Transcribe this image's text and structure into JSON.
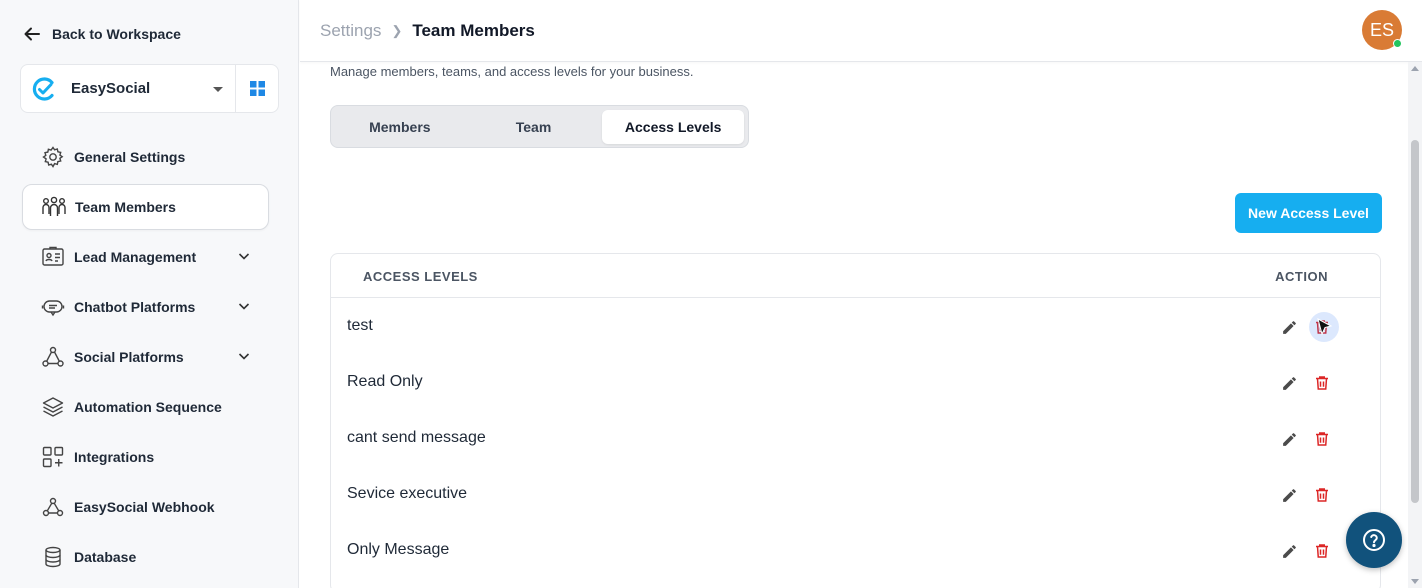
{
  "sidebar": {
    "back_label": "Back to Workspace",
    "workspace_name": "EasySocial",
    "items": [
      {
        "label": "General Settings",
        "icon": "gear-icon",
        "active": false,
        "expandable": false
      },
      {
        "label": "Team Members",
        "icon": "team-icon",
        "active": true,
        "expandable": false
      },
      {
        "label": "Lead Management",
        "icon": "contact-card-icon",
        "active": false,
        "expandable": true
      },
      {
        "label": "Chatbot Platforms",
        "icon": "chatbot-icon",
        "active": false,
        "expandable": true
      },
      {
        "label": "Social Platforms",
        "icon": "social-network-icon",
        "active": false,
        "expandable": true
      },
      {
        "label": "Automation Sequence",
        "icon": "layers-icon",
        "active": false,
        "expandable": false
      },
      {
        "label": "Integrations",
        "icon": "integrations-icon",
        "active": false,
        "expandable": false
      },
      {
        "label": "EasySocial Webhook",
        "icon": "webhook-icon",
        "active": false,
        "expandable": false
      },
      {
        "label": "Database",
        "icon": "database-icon",
        "active": false,
        "expandable": false
      }
    ]
  },
  "header": {
    "breadcrumb_parent": "Settings",
    "breadcrumb_current": "Team Members",
    "avatar_initials": "ES",
    "status": "online"
  },
  "main": {
    "description": "Manage members, teams, and access levels for your business.",
    "tabs": [
      {
        "label": "Members",
        "active": false
      },
      {
        "label": "Team",
        "active": false
      },
      {
        "label": "Access Levels",
        "active": true
      }
    ],
    "new_button_label": "New Access Level",
    "table": {
      "col_name": "ACCESS LEVELS",
      "col_action": "ACTION",
      "rows": [
        {
          "name": "test"
        },
        {
          "name": "Read Only"
        },
        {
          "name": "cant send message"
        },
        {
          "name": "Sevice executive"
        },
        {
          "name": "Only Message"
        }
      ]
    }
  },
  "colors": {
    "accent": "#16aef0",
    "delete": "#dc2626",
    "help_button": "#11527c",
    "avatar": "#d97b35"
  }
}
